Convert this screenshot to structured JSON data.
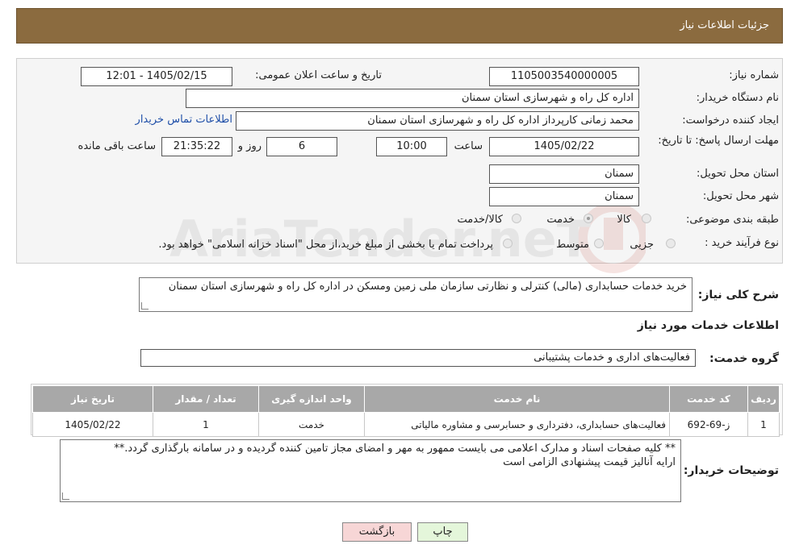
{
  "header": {
    "title": "جزئیات اطلاعات نیاز"
  },
  "form": {
    "need_number_label": "شماره نیاز:",
    "need_number": "1105003540000005",
    "announce_label": "تاریخ و ساعت اعلان عمومی:",
    "announce_value": "1405/02/15 - 12:01",
    "buyer_org_label": "نام دستگاه خریدار:",
    "buyer_org": "اداره کل راه و شهرسازی استان سمنان",
    "creator_label": "ایجاد کننده درخواست:",
    "creator": "محمد زمانی کارپرداز اداره کل راه و شهرسازی استان سمنان",
    "contact_link": "اطلاعات تماس خریدار",
    "deadline_label": "مهلت ارسال پاسخ: تا تاریخ:",
    "deadline_date": "1405/02/22",
    "hour_label": "ساعت",
    "deadline_time": "10:00",
    "days_value": "6",
    "days_label": "روز و",
    "remaining_time": "21:35:22",
    "remaining_label": "ساعت باقی مانده",
    "province_label": "استان محل تحویل:",
    "province": "سمنان",
    "city_label": "شهر محل تحویل:",
    "city": "سمنان",
    "category_label": "طبقه بندی موضوعی:",
    "category_options": [
      "کالا",
      "خدمت",
      "کالا/خدمت"
    ],
    "category_selected": "خدمت",
    "process_label": "نوع فرآیند خرید :",
    "process_options": [
      "جزیی",
      "متوسط"
    ],
    "process_note": "پرداخت تمام یا بخشی از مبلغ خرید،از محل \"اسناد خزانه اسلامی\" خواهد بود."
  },
  "summary": {
    "label": "شرح کلی نیاز:",
    "text": "خرید خدمات حسابداری (مالی) کنترلی و نظارتی سازمان ملی زمین ومسکن در اداره کل راه و شهرسازی استان سمنان"
  },
  "services": {
    "section_title": "اطلاعات خدمات مورد نیاز",
    "group_label": "گروه خدمت:",
    "group_value": "فعالیت‌های اداری و خدمات پشتیبانی",
    "table_headers": [
      "ردیف",
      "کد خدمت",
      "نام خدمت",
      "واحد اندازه گیری",
      "تعداد / مقدار",
      "تاریخ نیاز"
    ],
    "rows": [
      [
        "1",
        "ز-69-692",
        "فعالیت‌های حسابداری، دفترداری و حسابرسی و مشاوره مالیاتی",
        "خدمت",
        "1",
        "1405/02/22"
      ]
    ]
  },
  "buyer_notes": {
    "label": "توضیحات خریدار:",
    "line1": "** کلیه صفحات اسناد و مدارک اعلامی می بایست ممهور به مهر و امضای مجاز تامین کننده گردیده و در سامانه بارگذاری گردد.**",
    "line2": "ارایه آنالیز قیمت پیشنهادی الزامی است"
  },
  "buttons": {
    "print": "چاپ",
    "back": "بازگشت"
  },
  "watermark": "AriaTender.neT",
  "colors": {
    "header_bg": "#8b6b3f",
    "table_header_bg": "#a8a8a8",
    "back_button_bg": "#f7d6d6",
    "print_button_bg": "#e4f6da"
  }
}
